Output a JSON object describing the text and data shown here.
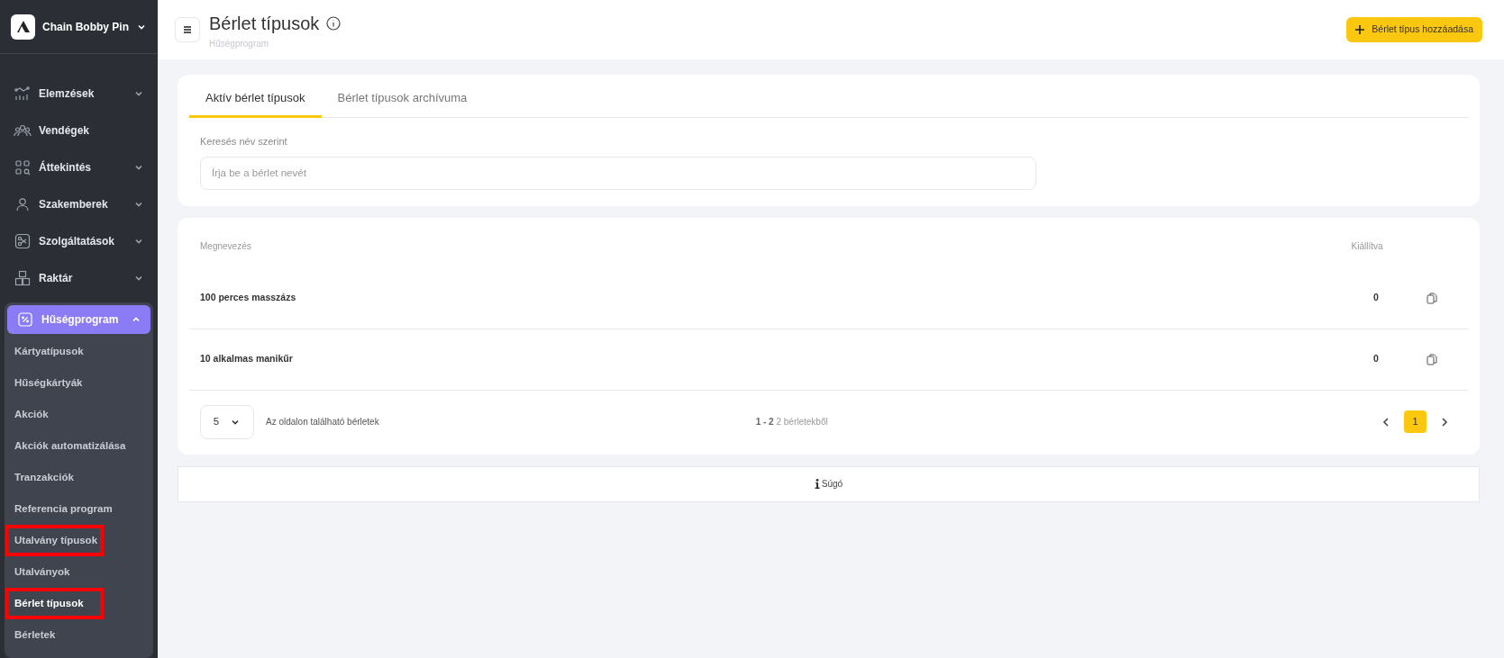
{
  "brand": {
    "name": "Chain Bobby Pin"
  },
  "sidebar": {
    "items": [
      {
        "label": "Elemzések",
        "kind": "chart",
        "has_caret": true,
        "expanded": false,
        "selected": false
      },
      {
        "label": "Vendégek",
        "kind": "users",
        "has_caret": false,
        "selected": false
      },
      {
        "label": "Áttekintés",
        "kind": "grid",
        "has_caret": true,
        "expanded": false,
        "selected": false
      },
      {
        "label": "Szakemberek",
        "kind": "user",
        "has_caret": true,
        "expanded": false,
        "selected": false
      },
      {
        "label": "Szolgáltatások",
        "kind": "scissors",
        "has_caret": true,
        "expanded": false,
        "selected": false
      },
      {
        "label": "Raktár",
        "kind": "boxes",
        "has_caret": true,
        "expanded": false,
        "selected": false
      },
      {
        "label": "Hűségprogram",
        "kind": "percent",
        "has_caret": true,
        "expanded": true,
        "selected": true,
        "children": [
          {
            "label": "Kártyatípusok",
            "selected": false,
            "highlighted": false
          },
          {
            "label": "Hűségkártyák",
            "selected": false,
            "highlighted": false
          },
          {
            "label": "Akciók",
            "selected": false,
            "highlighted": false
          },
          {
            "label": "Akciók automatizálása",
            "selected": false,
            "highlighted": false
          },
          {
            "label": "Tranzakciók",
            "selected": false,
            "highlighted": false
          },
          {
            "label": "Referencia program",
            "selected": false,
            "highlighted": false
          },
          {
            "label": "Utalvány típusok",
            "selected": false,
            "highlighted": true
          },
          {
            "label": "Utalványok",
            "selected": false,
            "highlighted": false
          },
          {
            "label": "Bérlet típusok",
            "selected": true,
            "highlighted": true
          },
          {
            "label": "Bérletek",
            "selected": false,
            "highlighted": false
          }
        ]
      }
    ]
  },
  "header": {
    "title": "Bérlet típusok",
    "subtitle": "Hűségprogram",
    "add_button": "Bérlet típus hozzáadása"
  },
  "tabs": [
    {
      "label": "Aktív bérlet típusok",
      "selected": true
    },
    {
      "label": "Bérlet típusok archívuma",
      "selected": false
    }
  ],
  "search": {
    "label": "Keresés név szerint",
    "placeholder": "Írja be a bérlet nevét"
  },
  "table": {
    "columns": [
      "Megnevezés",
      "Kiállítva"
    ],
    "rows": [
      {
        "name": "100 perces masszázs",
        "issued": "0"
      },
      {
        "name": "10 alkalmas manikűr",
        "issued": "0"
      }
    ]
  },
  "pagination": {
    "page_size": "5",
    "page_size_label": "Az oldalon található bérletek",
    "range": "1 - 2",
    "total": "2 bérletekből",
    "pages": [
      {
        "label": "1",
        "selected": true
      }
    ]
  },
  "help": {
    "label": "Súgó"
  }
}
